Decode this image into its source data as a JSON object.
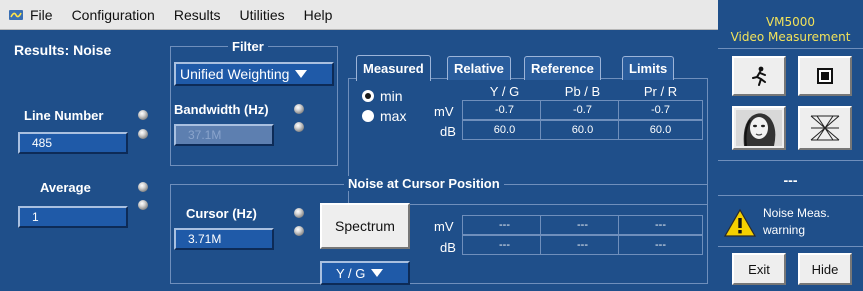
{
  "menu": {
    "items": [
      "File",
      "Configuration",
      "Results",
      "Utilities",
      "Help"
    ]
  },
  "panel": {
    "title": "Results: Noise",
    "line_number": {
      "label": "Line Number",
      "value": "485"
    },
    "average": {
      "label": "Average",
      "value": "1"
    },
    "filter": {
      "group_label": "Filter",
      "selected": "Unified Weighting",
      "bandwidth_label": "Bandwidth (Hz)",
      "bandwidth_value": "37.1M"
    },
    "tabs": [
      "Measured",
      "Relative",
      "Reference",
      "Limits"
    ],
    "active_tab": "Measured",
    "radio": {
      "min_label": "min",
      "max_label": "max",
      "selected": "min"
    },
    "columns": [
      "Y / G",
      "Pb / B",
      "Pr / R"
    ],
    "units": [
      "mV",
      "dB"
    ],
    "measured": {
      "mV": [
        "-0.7",
        "-0.7",
        "-0.7"
      ],
      "dB": [
        "60.0",
        "60.0",
        "60.0"
      ]
    },
    "cursor_group": {
      "label": "Noise at Cursor Position",
      "cursor_label": "Cursor (Hz)",
      "cursor_value": "3.71M",
      "spectrum_label": "Spectrum",
      "units": [
        "mV",
        "dB"
      ],
      "mV": [
        "---",
        "---",
        "---"
      ],
      "dB": [
        "---",
        "---",
        "---"
      ],
      "channel_selected": "Y / G"
    }
  },
  "side": {
    "title_line1": "VM5000",
    "title_line2": "Video Measurement",
    "status_dashes": "---",
    "warning_text": "Noise Meas. warning",
    "exit_label": "Exit",
    "hide_label": "Hide"
  },
  "colors": {
    "panel_bg": "#1f4f8a",
    "field_bg": "#1f5aa8",
    "title_accent": "#f2e25a",
    "warning": "#f5d000"
  },
  "icons": [
    "app-logo-icon",
    "run-icon",
    "stop-icon",
    "face-image-icon",
    "mesh-icon",
    "warning-icon",
    "dropdown-arrow-icon",
    "knob-icon"
  ]
}
